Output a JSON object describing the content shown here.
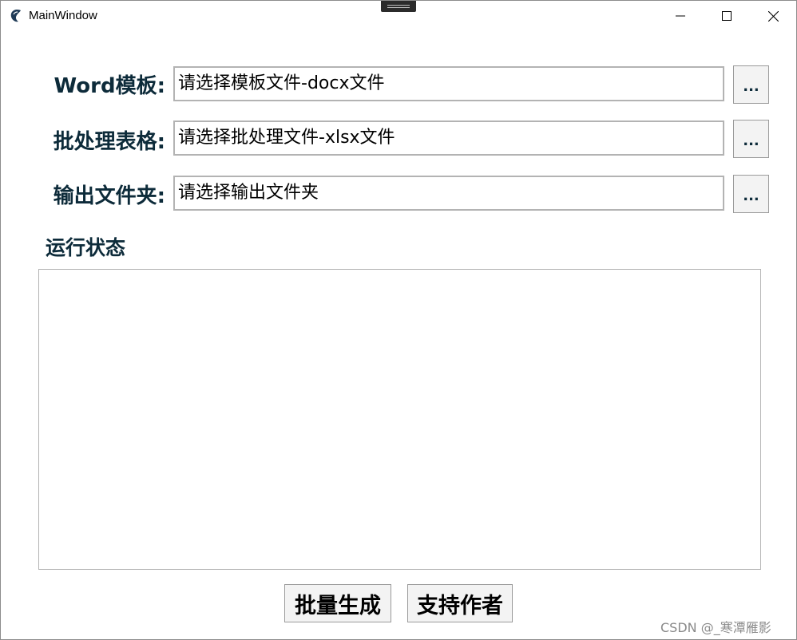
{
  "window": {
    "title": "MainWindow"
  },
  "form": {
    "rows": [
      {
        "label": "Word模板:",
        "value": "请选择模板文件-docx文件",
        "button": "..."
      },
      {
        "label": "批处理表格:",
        "value": "请选择批处理文件-xlsx文件",
        "button": "..."
      },
      {
        "label": "输出文件夹:",
        "value": "请选择输出文件夹",
        "button": "..."
      }
    ]
  },
  "status": {
    "label": "运行状态",
    "log": ""
  },
  "actions": {
    "generate_label": "批量生成",
    "support_label": "支持作者"
  },
  "watermark": "CSDN @_寒潭雁影",
  "icons": {
    "app": "qt-app-icon",
    "minimize": "minimize-icon",
    "maximize": "maximize-icon",
    "close": "close-icon"
  }
}
